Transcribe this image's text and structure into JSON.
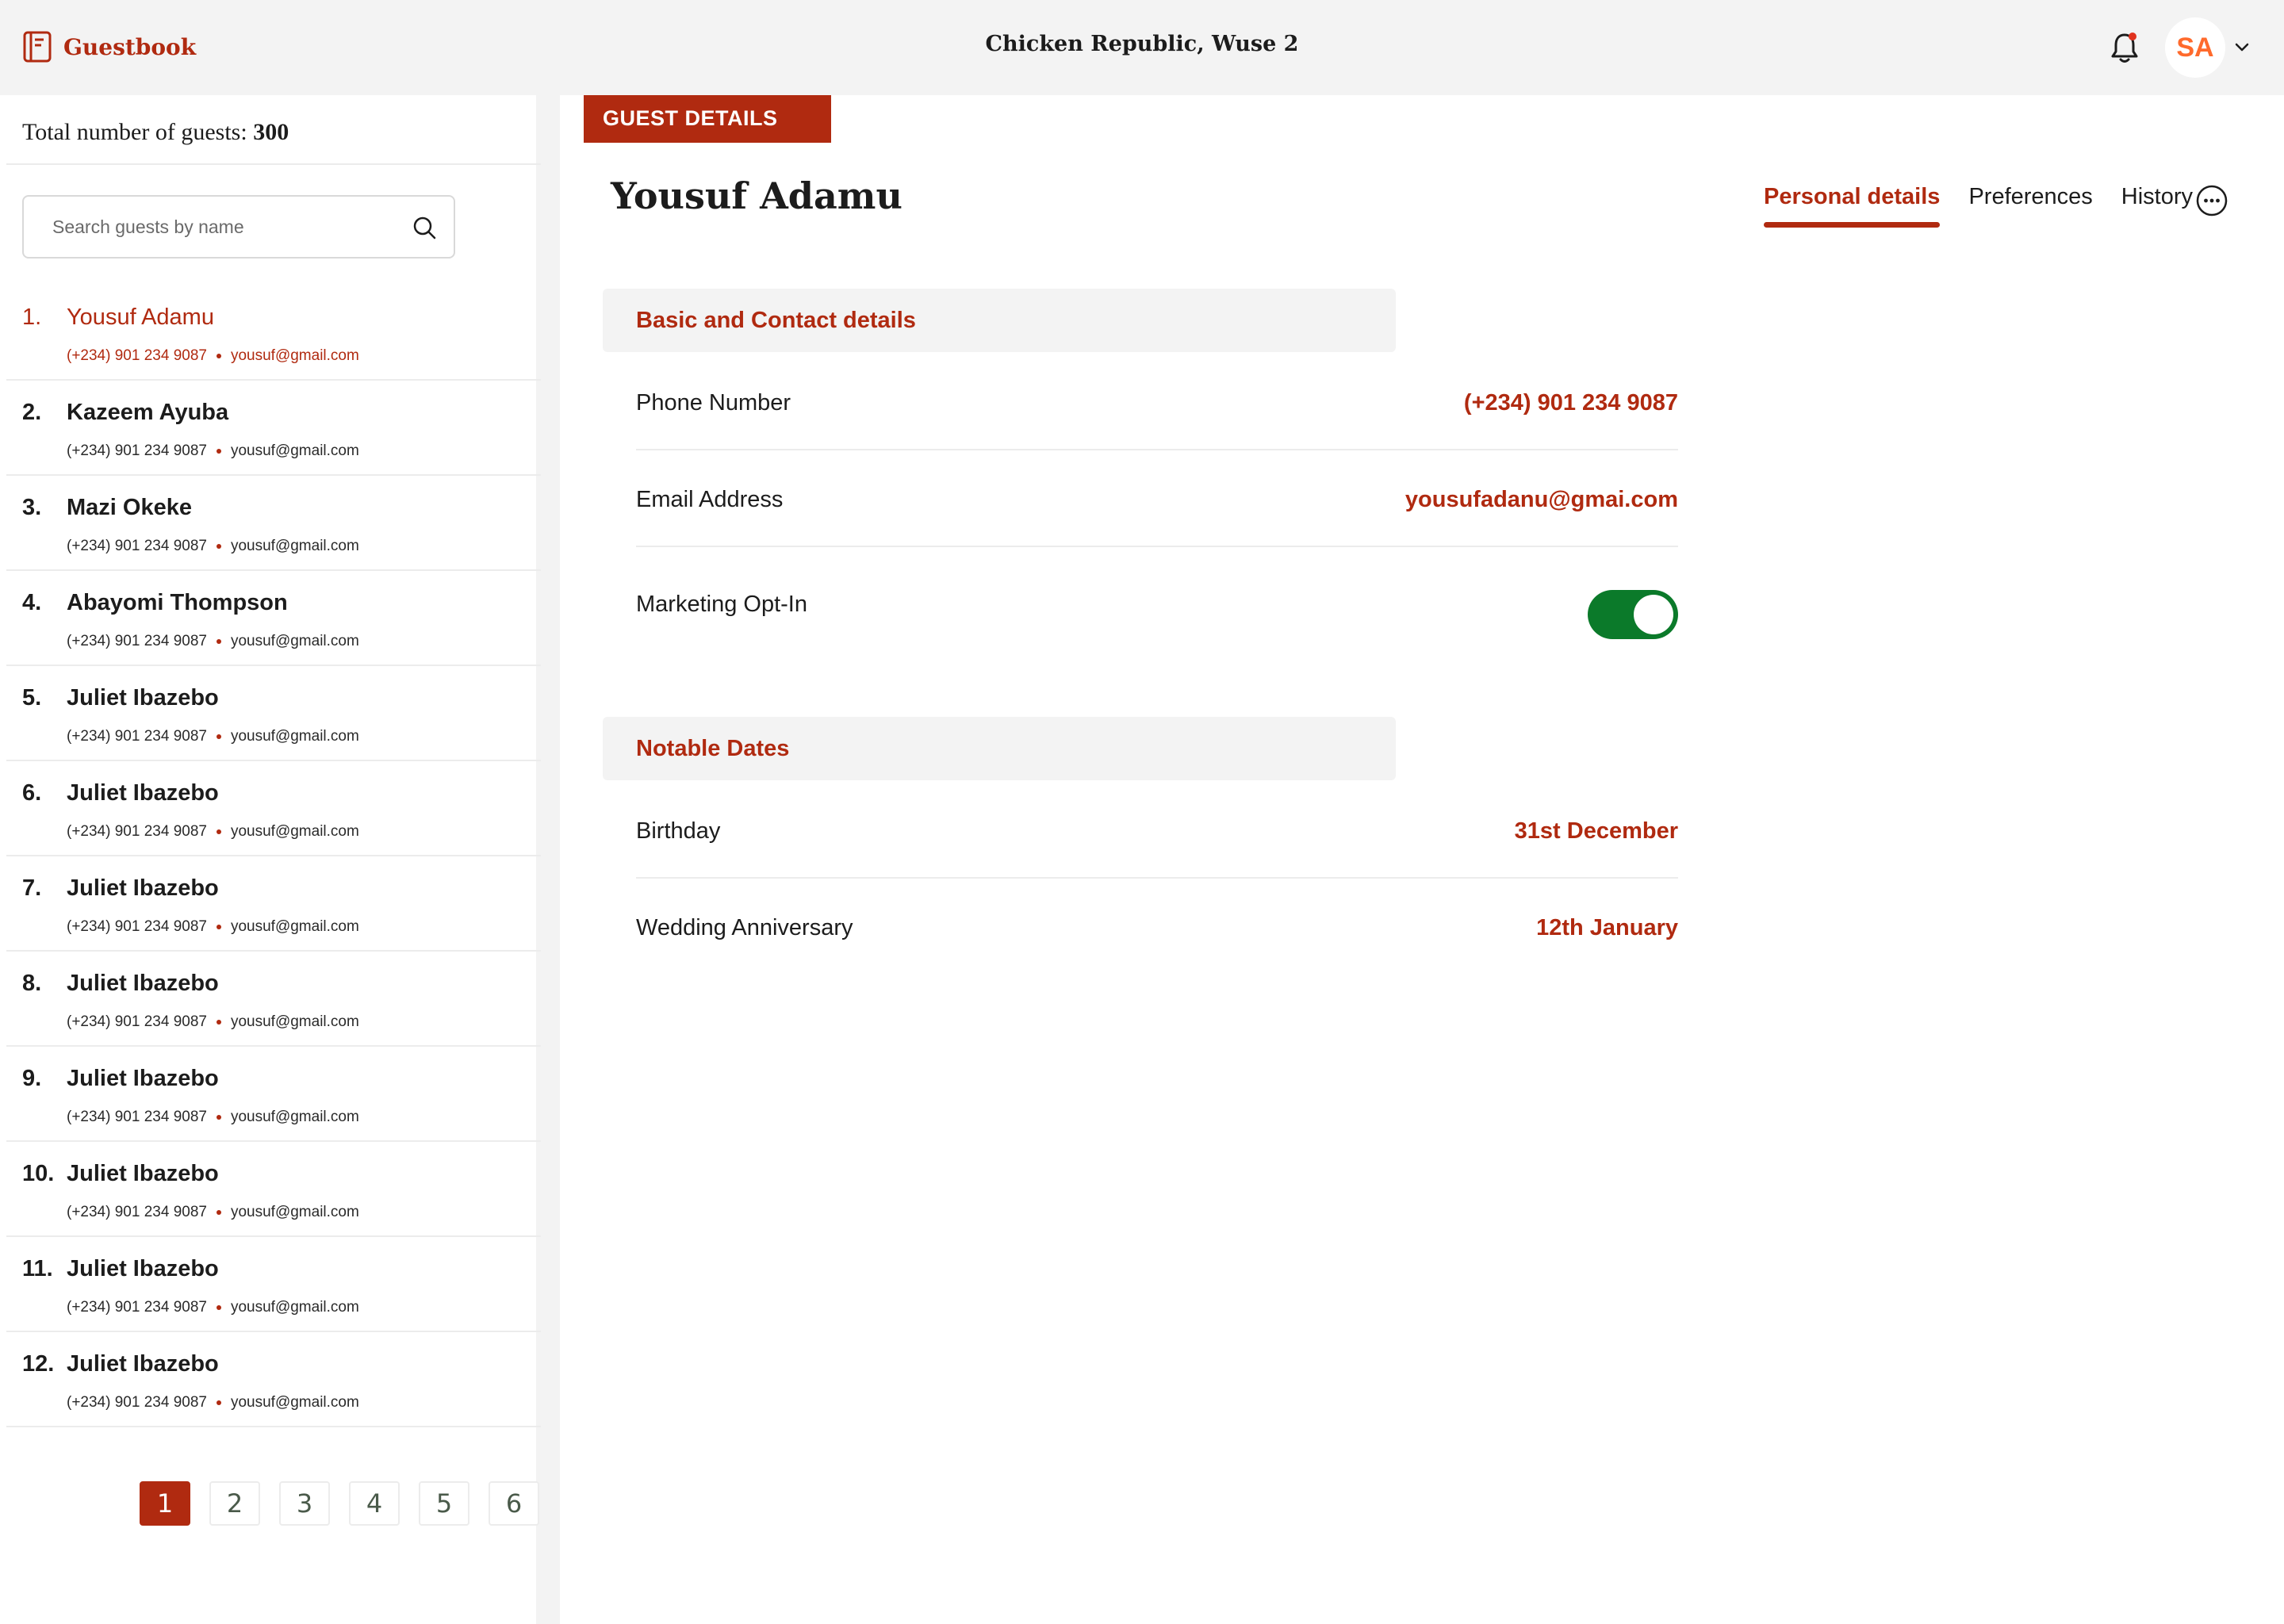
{
  "app": {
    "brand": "Guestbook",
    "location": "Chicken Republic, Wuse 2",
    "user_initials": "SA"
  },
  "sidebar": {
    "total_label": "Total number of guests:",
    "total_count": "300",
    "search_placeholder": "Search guests by name",
    "guests": [
      {
        "num": "1.",
        "name": "Yousuf Adamu",
        "phone": "(+234) 901 234 9087",
        "email": "yousuf@gmail.com"
      },
      {
        "num": "2.",
        "name": "Kazeem Ayuba",
        "phone": "(+234) 901 234 9087",
        "email": "yousuf@gmail.com"
      },
      {
        "num": "3.",
        "name": "Mazi Okeke",
        "phone": "(+234) 901 234 9087",
        "email": "yousuf@gmail.com"
      },
      {
        "num": "4.",
        "name": "Abayomi Thompson",
        "phone": "(+234) 901 234 9087",
        "email": "yousuf@gmail.com"
      },
      {
        "num": "5.",
        "name": "Juliet Ibazebo",
        "phone": "(+234) 901 234 9087",
        "email": "yousuf@gmail.com"
      },
      {
        "num": "6.",
        "name": "Juliet Ibazebo",
        "phone": "(+234) 901 234 9087",
        "email": "yousuf@gmail.com"
      },
      {
        "num": "7.",
        "name": "Juliet Ibazebo",
        "phone": "(+234) 901 234 9087",
        "email": "yousuf@gmail.com"
      },
      {
        "num": "8.",
        "name": "Juliet Ibazebo",
        "phone": "(+234) 901 234 9087",
        "email": "yousuf@gmail.com"
      },
      {
        "num": "9.",
        "name": "Juliet Ibazebo",
        "phone": "(+234) 901 234 9087",
        "email": "yousuf@gmail.com"
      },
      {
        "num": "10.",
        "name": "Juliet Ibazebo",
        "phone": "(+234) 901 234 9087",
        "email": "yousuf@gmail.com"
      },
      {
        "num": "11.",
        "name": "Juliet Ibazebo",
        "phone": "(+234) 901 234 9087",
        "email": "yousuf@gmail.com"
      },
      {
        "num": "12.",
        "name": "Juliet Ibazebo",
        "phone": "(+234) 901 234 9087",
        "email": "yousuf@gmail.com"
      }
    ],
    "pages": [
      "1",
      "2",
      "3",
      "4",
      "5",
      "6"
    ],
    "active_page": "1"
  },
  "main": {
    "tag": "GUEST DETAILS",
    "guest_name": "Yousuf Adamu",
    "tabs": [
      {
        "label": "Personal details",
        "active": true
      },
      {
        "label": "Preferences",
        "active": false
      },
      {
        "label": "History",
        "active": false
      }
    ],
    "sections": {
      "contact_title": "Basic and Contact details",
      "phone_label": "Phone Number",
      "phone_value": "(+234) 901 234 9087",
      "email_label": "Email Address",
      "email_value": "yousufadanu@gmai.com",
      "marketing_label": "Marketing Opt-In",
      "marketing_on": true,
      "dates_title": "Notable Dates",
      "birthday_label": "Birthday",
      "birthday_value": "31st December",
      "anniversary_label": "Wedding Anniversary",
      "anniversary_value": "12th January"
    }
  },
  "icons": {
    "brand": "book-icon",
    "notifications": "bell-icon",
    "dropdown": "chevron-down-icon",
    "search": "search-icon",
    "more": "more-horizontal-icon"
  },
  "colors": {
    "accent": "#b02a10",
    "toggle_on": "#0b7a2a",
    "avatar_text": "#ff6a2c",
    "chrome_bg": "#f3f3f3"
  }
}
